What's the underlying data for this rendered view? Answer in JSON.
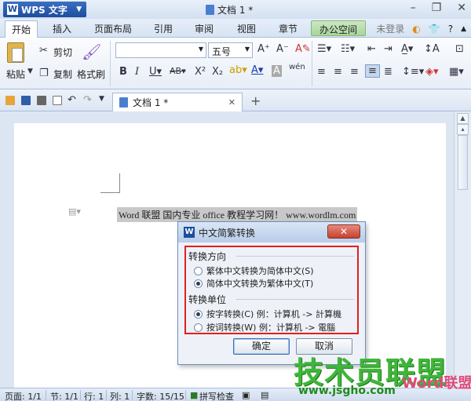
{
  "titlebar": {
    "app_name": "WPS 文字",
    "doc_title": "文档 1 *",
    "app_logo": "W"
  },
  "menu": {
    "tabs": [
      "开始",
      "插入",
      "页面布局",
      "引用",
      "审阅",
      "视图",
      "章节",
      "办公空间"
    ],
    "login": "未登录"
  },
  "ribbon": {
    "paste": "粘贴",
    "cut": "剪切",
    "copy": "复制",
    "format_painter": "格式刷",
    "font_size": "五号"
  },
  "doc_tab": {
    "title": "文档 1 *"
  },
  "document": {
    "selected_text": "Word 联盟  国内专业 office 教程学习网！ www.wordlm.com"
  },
  "dialog": {
    "title": "中文简繁转换",
    "logo": "W",
    "group1_title": "转换方向",
    "opt_t2s": "繁体中文转换为简体中文(S)",
    "opt_s2t": "简体中文转换为繁体中文(T)",
    "group2_title": "转换单位",
    "opt_char": "按字转换(C)  例：计算机 -> 計算機",
    "opt_word": "按词转换(W)  例：计算机 -> 電腦",
    "ok": "确定",
    "cancel": "取消"
  },
  "status": {
    "page": "页面: 1/1",
    "section": "节: 1/1",
    "row": "行: 1",
    "col": "列: 1",
    "words": "字数: 15/15",
    "spell": "拼写检查"
  },
  "watermark": {
    "big": "技术员联盟",
    "url": "www.jsgho.com",
    "word_logo": "Word联盟"
  }
}
